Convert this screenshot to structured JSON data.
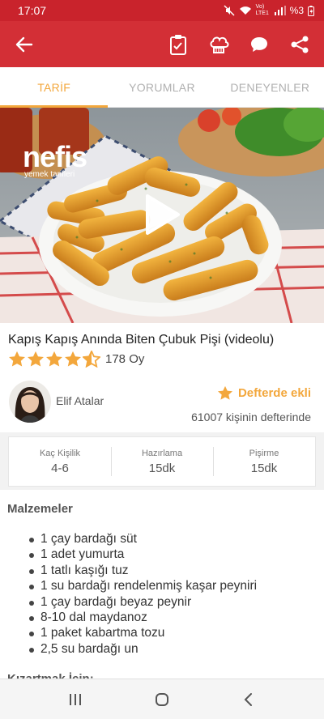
{
  "status_bar": {
    "time": "17:07",
    "network": "Vo) LTE1",
    "battery": "%3"
  },
  "toolbar": {
    "icons": [
      "back-arrow",
      "checklist",
      "chef-hat",
      "comment",
      "share"
    ]
  },
  "tabs": [
    {
      "label": "TARİF",
      "active": true
    },
    {
      "label": "YORUMLAR",
      "active": false
    },
    {
      "label": "DENEYENLER",
      "active": false
    }
  ],
  "hero": {
    "brand": "nefis",
    "brand_sub": "yemek tarifleri",
    "play_icon": "play"
  },
  "recipe": {
    "title": "Kapış Kapış Anında Biten Çubuk Pişi (videolu)",
    "rating_stars": 4.5,
    "votes": "178 Oy",
    "author": "Elif Atalar",
    "saved_label": "Defterde ekli",
    "saved_count": "61007 kişinin defterinde"
  },
  "stats": [
    {
      "label": "Kaç Kişilik",
      "value": "4-6"
    },
    {
      "label": "Hazırlama",
      "value": "15dk"
    },
    {
      "label": "Pişirme",
      "value": "15dk"
    }
  ],
  "ingredients": {
    "title": "Malzemeler",
    "items": [
      "1 çay bardağı süt",
      "1 adet yumurta",
      "1 tatlı kaşığı tuz",
      "1 su bardağı rendelenmiş kaşar peyniri",
      "1 çay bardağı beyaz peynir",
      "8-10 dal maydanoz",
      "1 paket kabartma tozu",
      "2,5 su bardağı un"
    ],
    "next_section": "Kızartmak İçin:"
  },
  "colors": {
    "primary": "#d32f36",
    "accent": "#f3a73c"
  }
}
